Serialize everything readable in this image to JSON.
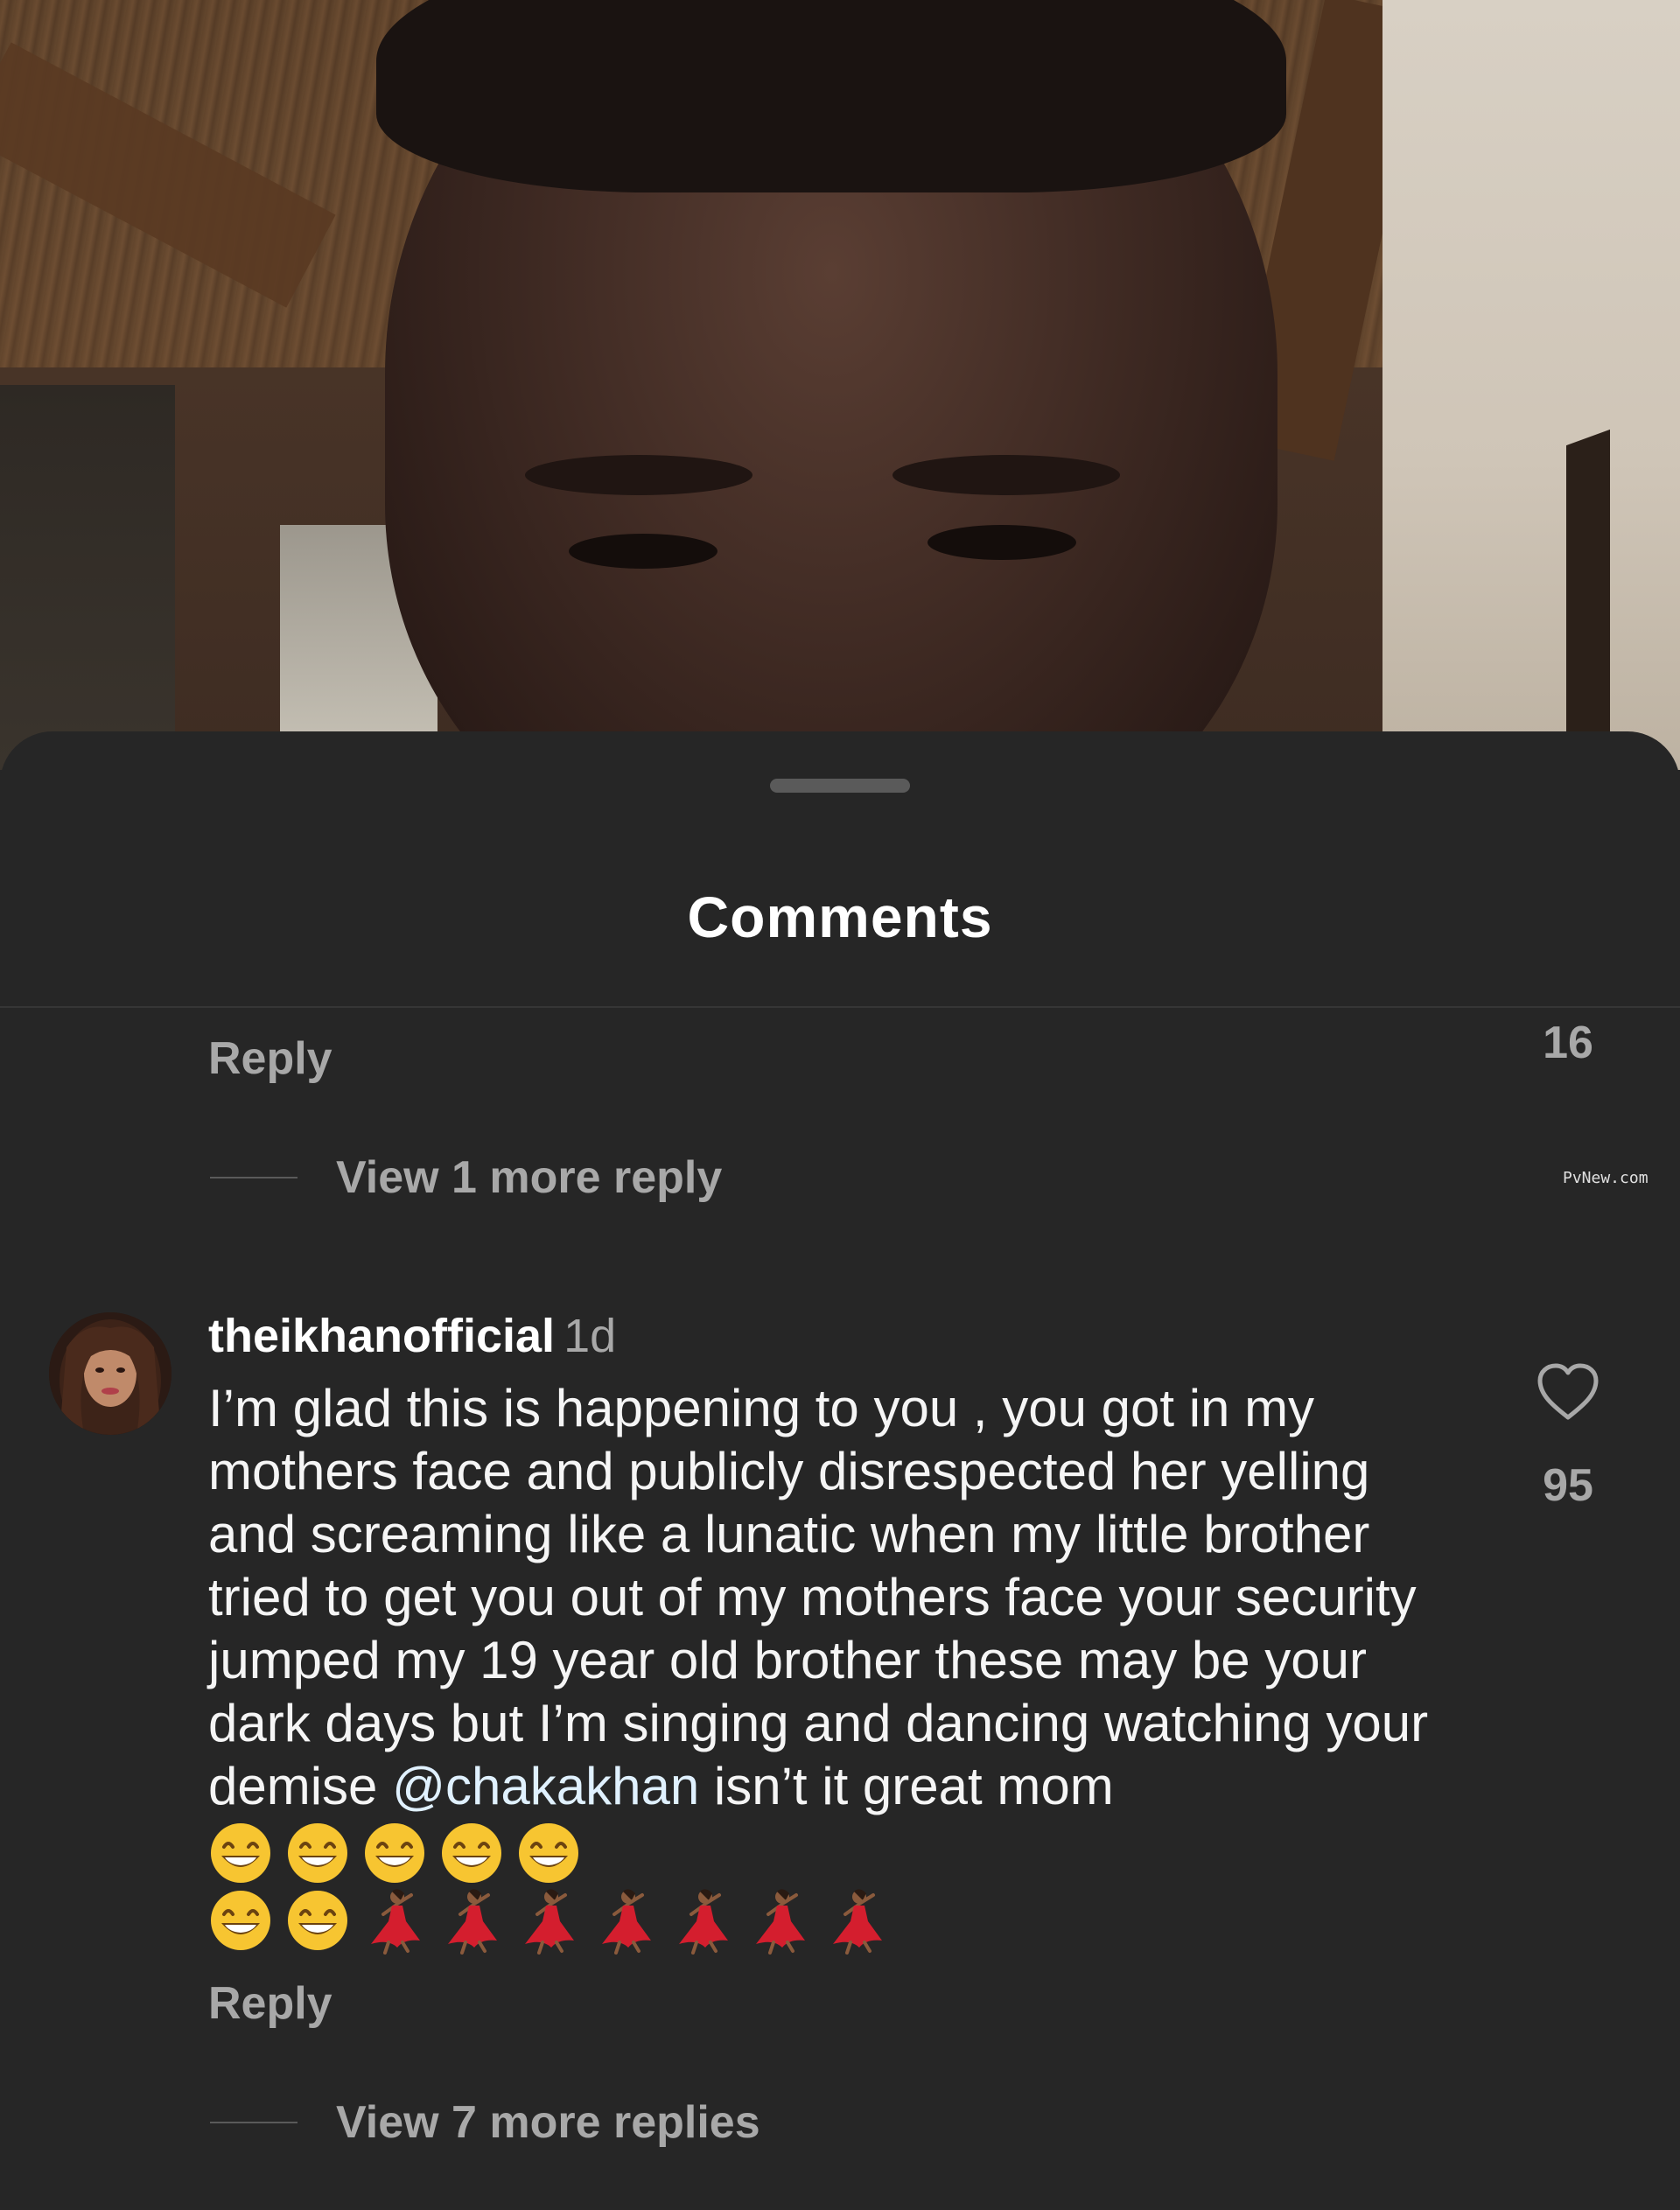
{
  "sheet": {
    "title": "Comments"
  },
  "previous_comment": {
    "reply_label": "Reply",
    "like_count": "16",
    "view_replies_label": "View 1 more reply"
  },
  "watermark": "PvNew.com",
  "comment": {
    "username": "theikhanofficial",
    "timestamp": "1d",
    "text_part1": "I’m glad this is happening to you , you got in my mothers face and publicly disrespected her yelling and screaming like a lunatic when my little brother tried to get you out of my mothers face your security jumped my 19 year old brother these may be your dark days but I’m singing and dancing watching your demise ",
    "mention": "@chakakhan",
    "text_part2": " isn’t it great mom ",
    "emojis": {
      "grinning_count_first": 5,
      "grinning_count_second": 2,
      "dancer_count": 7
    },
    "like_count": "95",
    "reply_label": "Reply",
    "view_replies_label": "View 7 more replies",
    "icons": {
      "like": "heart-icon",
      "avatar": "avatar"
    }
  },
  "colors": {
    "sheet_bg": "#262626",
    "primary_text": "#ffffff",
    "secondary_text": "#a8a8a8",
    "mention": "#e0f1ff"
  }
}
